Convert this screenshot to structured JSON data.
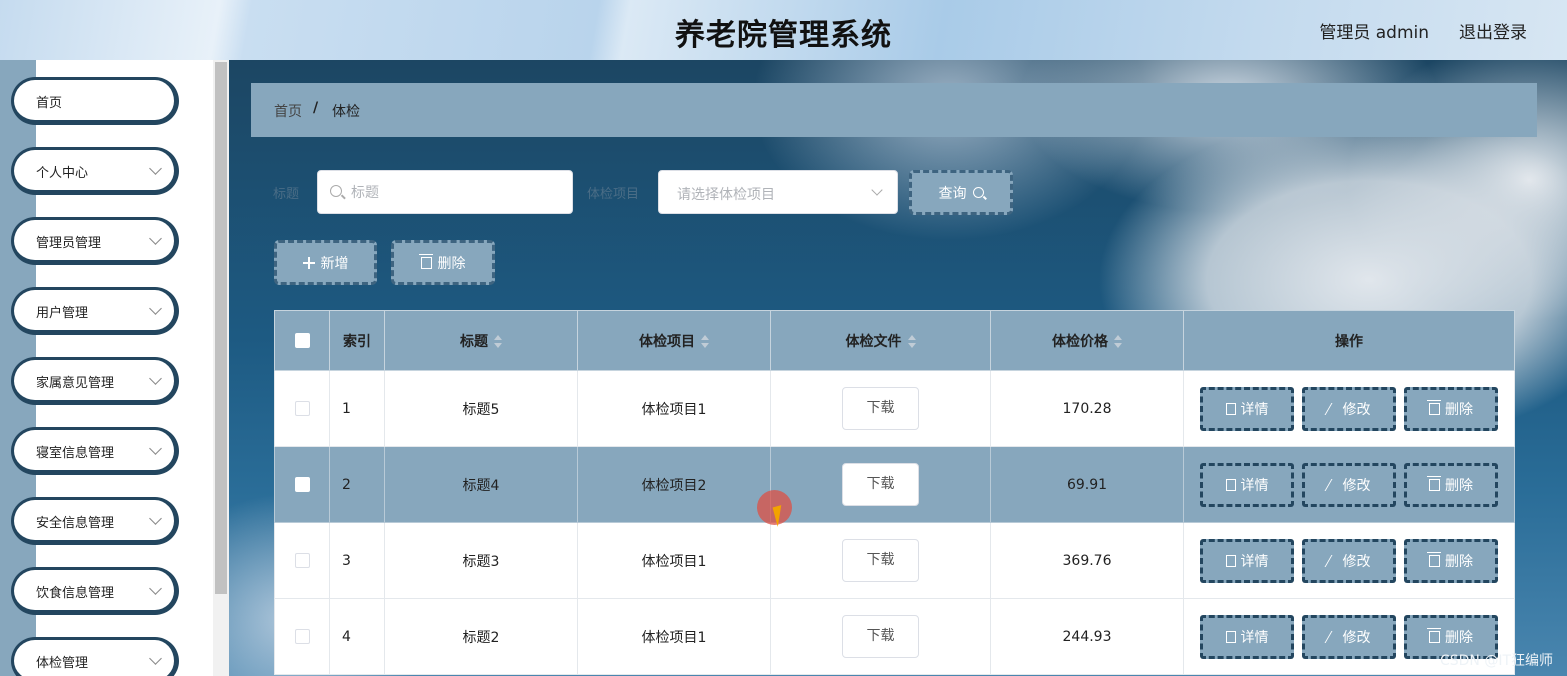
{
  "header": {
    "title": "养老院管理系统",
    "user": "管理员 admin",
    "logout": "退出登录"
  },
  "sidebar": {
    "items": [
      {
        "label": "首页",
        "has_submenu": false
      },
      {
        "label": "个人中心",
        "has_submenu": true
      },
      {
        "label": "管理员管理",
        "has_submenu": true
      },
      {
        "label": "用户管理",
        "has_submenu": true
      },
      {
        "label": "家属意见管理",
        "has_submenu": true
      },
      {
        "label": "寝室信息管理",
        "has_submenu": true
      },
      {
        "label": "安全信息管理",
        "has_submenu": true
      },
      {
        "label": "饮食信息管理",
        "has_submenu": true
      },
      {
        "label": "体检管理",
        "has_submenu": true
      }
    ]
  },
  "breadcrumb": {
    "home": "首页",
    "separator": "/",
    "current": "体检"
  },
  "search": {
    "title_label": "标题",
    "title_placeholder": "标题",
    "item_label": "体检项目",
    "item_placeholder": "请选择体检项目",
    "query_button": "查询"
  },
  "actions": {
    "add": "新增",
    "delete": "删除"
  },
  "table": {
    "columns": [
      "索引",
      "标题",
      "体检项目",
      "体检文件",
      "体检价格",
      "操作"
    ],
    "download_label": "下载",
    "op_labels": {
      "detail": "详情",
      "edit": "修改",
      "delete": "删除"
    },
    "rows": [
      {
        "index": "1",
        "title": "标题5",
        "item": "体检项目1",
        "price": "170.28"
      },
      {
        "index": "2",
        "title": "标题4",
        "item": "体检项目2",
        "price": "69.91"
      },
      {
        "index": "3",
        "title": "标题3",
        "item": "体检项目1",
        "price": "369.76"
      },
      {
        "index": "4",
        "title": "标题2",
        "item": "体检项目1",
        "price": "244.93"
      }
    ]
  },
  "watermark": "CSDN @IT狂编师",
  "colors": {
    "accent": "#87a7bd",
    "dark": "#23465f"
  }
}
